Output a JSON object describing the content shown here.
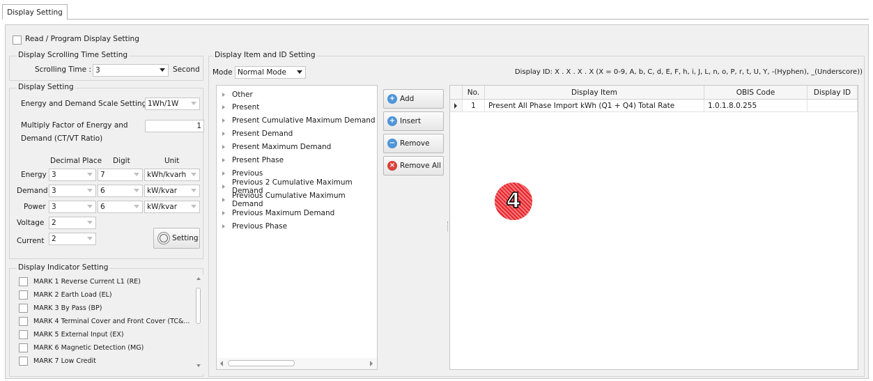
{
  "tab": {
    "label": "Display Setting"
  },
  "read_program": {
    "label": "Read / Program Display Setting"
  },
  "scrolling": {
    "group_title": "Display Scrolling Time Setting",
    "label": "Scrolling Time :",
    "value": "3",
    "unit": "Second"
  },
  "display_setting": {
    "group_title": "Display Setting",
    "scale_label": "Energy and Demand Scale Setting",
    "scale_value": "1Wh/1W",
    "multiply_label_1": "Multiply Factor of Energy and",
    "multiply_label_2": "Demand (CT/VT Ratio)",
    "multiply_value": "1",
    "col_decimal": "Decimal Place",
    "col_digit": "Digit",
    "col_unit": "Unit",
    "rows": [
      {
        "label": "Energy",
        "decimal": "3",
        "digit": "7",
        "unit": "kWh/kvarh"
      },
      {
        "label": "Demand",
        "decimal": "3",
        "digit": "6",
        "unit": "kW/kvar"
      },
      {
        "label": "Power",
        "decimal": "3",
        "digit": "6",
        "unit": "kW/kvar"
      },
      {
        "label": "Voltage",
        "decimal": "2"
      },
      {
        "label": "Current",
        "decimal": "2"
      }
    ],
    "setting_button": "Setting"
  },
  "indicator": {
    "group_title": "Display Indicator Setting",
    "marks": [
      "MARK 1 Reverse Current L1 (RE)",
      "MARK 2 Earth Load (EL)",
      "MARK 3 By Pass (BP)",
      "MARK 4 Terminal Cover and Front Cover (TC&...",
      "MARK 5 External Input (EX)",
      "MARK 6 Magnetic Detection (MG)",
      "MARK 7 Low Credit"
    ]
  },
  "item_id": {
    "group_title": "Display Item and ID Setting",
    "mode_label": "Mode",
    "mode_value": "Normal Mode",
    "display_id_hint": "Display ID: X . X . X . X  (X = 0-9, A, b, C, d, E, F, h, i, J, L, n, o, P, r, t, U, Y, -(Hyphen), _(Underscore))"
  },
  "tree_items": [
    "Other",
    "Present",
    "Present Cumulative Maximum Demand",
    "Present Demand",
    "Present Maximum Demand",
    "Present Phase",
    "Previous",
    "Previous 2 Cumulative Maximum Demand",
    "Previous Cumulative Maximum Demand",
    "Previous Maximum Demand",
    "Previous Phase"
  ],
  "buttons": {
    "add": "Add",
    "insert": "Insert",
    "remove": "Remove",
    "remove_all": "Remove All"
  },
  "grid": {
    "headers": {
      "no": "No.",
      "item": "Display Item",
      "obis": "OBIS Code",
      "id": "Display ID"
    },
    "rows": [
      {
        "no": "1",
        "item": "Present All Phase Import kWh (Q1 + Q4) Total Rate",
        "obis": "1.0.1.8.0.255",
        "id": ""
      }
    ]
  },
  "annotation": {
    "number": "4",
    "color": "#e8232a"
  }
}
